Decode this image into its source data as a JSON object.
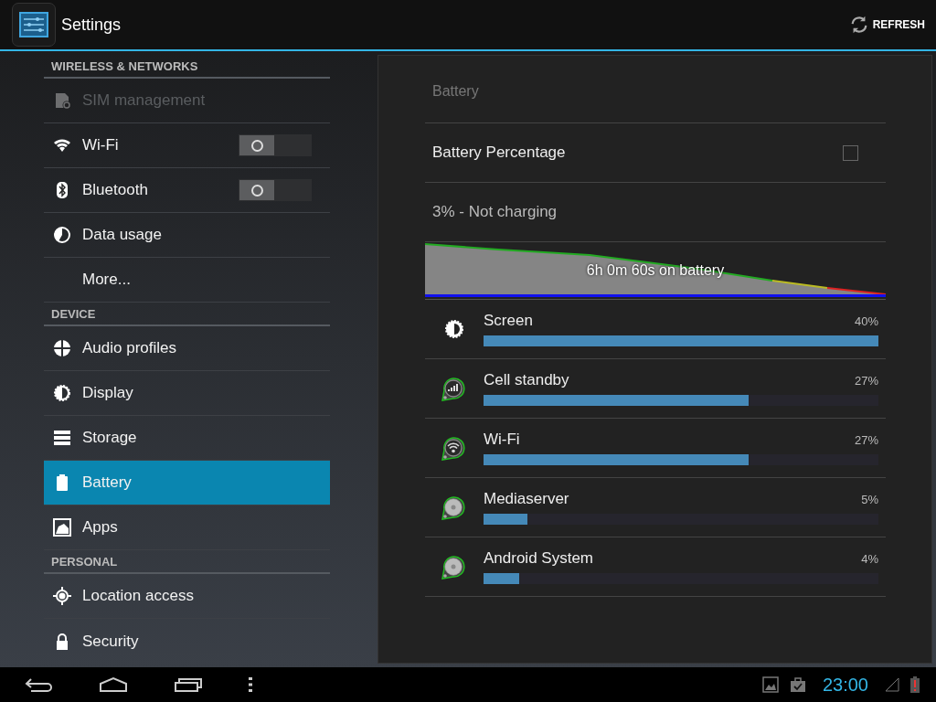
{
  "action_bar": {
    "title": "Settings",
    "refresh_label": "REFRESH"
  },
  "sidebar": {
    "items": [
      {
        "kind": "header",
        "label": "WIRELESS & NETWORKS"
      },
      {
        "kind": "item",
        "label": "SIM management",
        "disabled": true,
        "selected": false
      },
      {
        "kind": "toggle",
        "label": "Wi-Fi",
        "on": false,
        "selected": false
      },
      {
        "kind": "toggle",
        "label": "Bluetooth",
        "on": false,
        "selected": false
      },
      {
        "kind": "item",
        "label": "Data usage",
        "selected": false
      },
      {
        "kind": "item",
        "label": "More...",
        "selected": false
      },
      {
        "kind": "header",
        "label": "DEVICE"
      },
      {
        "kind": "item",
        "label": "Audio profiles",
        "selected": false
      },
      {
        "kind": "item",
        "label": "Display",
        "selected": false
      },
      {
        "kind": "item",
        "label": "Storage",
        "selected": false
      },
      {
        "kind": "item",
        "label": "Battery",
        "selected": true
      },
      {
        "kind": "item",
        "label": "Apps",
        "selected": false
      },
      {
        "kind": "header",
        "label": "PERSONAL"
      },
      {
        "kind": "item",
        "label": "Location access",
        "selected": false
      },
      {
        "kind": "item",
        "label": "Security",
        "selected": false
      }
    ]
  },
  "battery": {
    "title": "Battery",
    "percentage_label": "Battery Percentage",
    "percentage_checked": false,
    "status": "3% - Not charging",
    "graph_label": "6h 0m 60s on battery",
    "usage": [
      {
        "name": "Screen",
        "percent": "40%",
        "level": 1.0
      },
      {
        "name": "Cell standby",
        "percent": "27%",
        "level": 0.672
      },
      {
        "name": "Wi-Fi",
        "percent": "27%",
        "level": 0.672
      },
      {
        "name": "Mediaserver",
        "percent": "5%",
        "level": 0.111
      },
      {
        "name": "Android System",
        "percent": "4%",
        "level": 0.09
      }
    ]
  },
  "status_bar": {
    "time": "23:00"
  }
}
